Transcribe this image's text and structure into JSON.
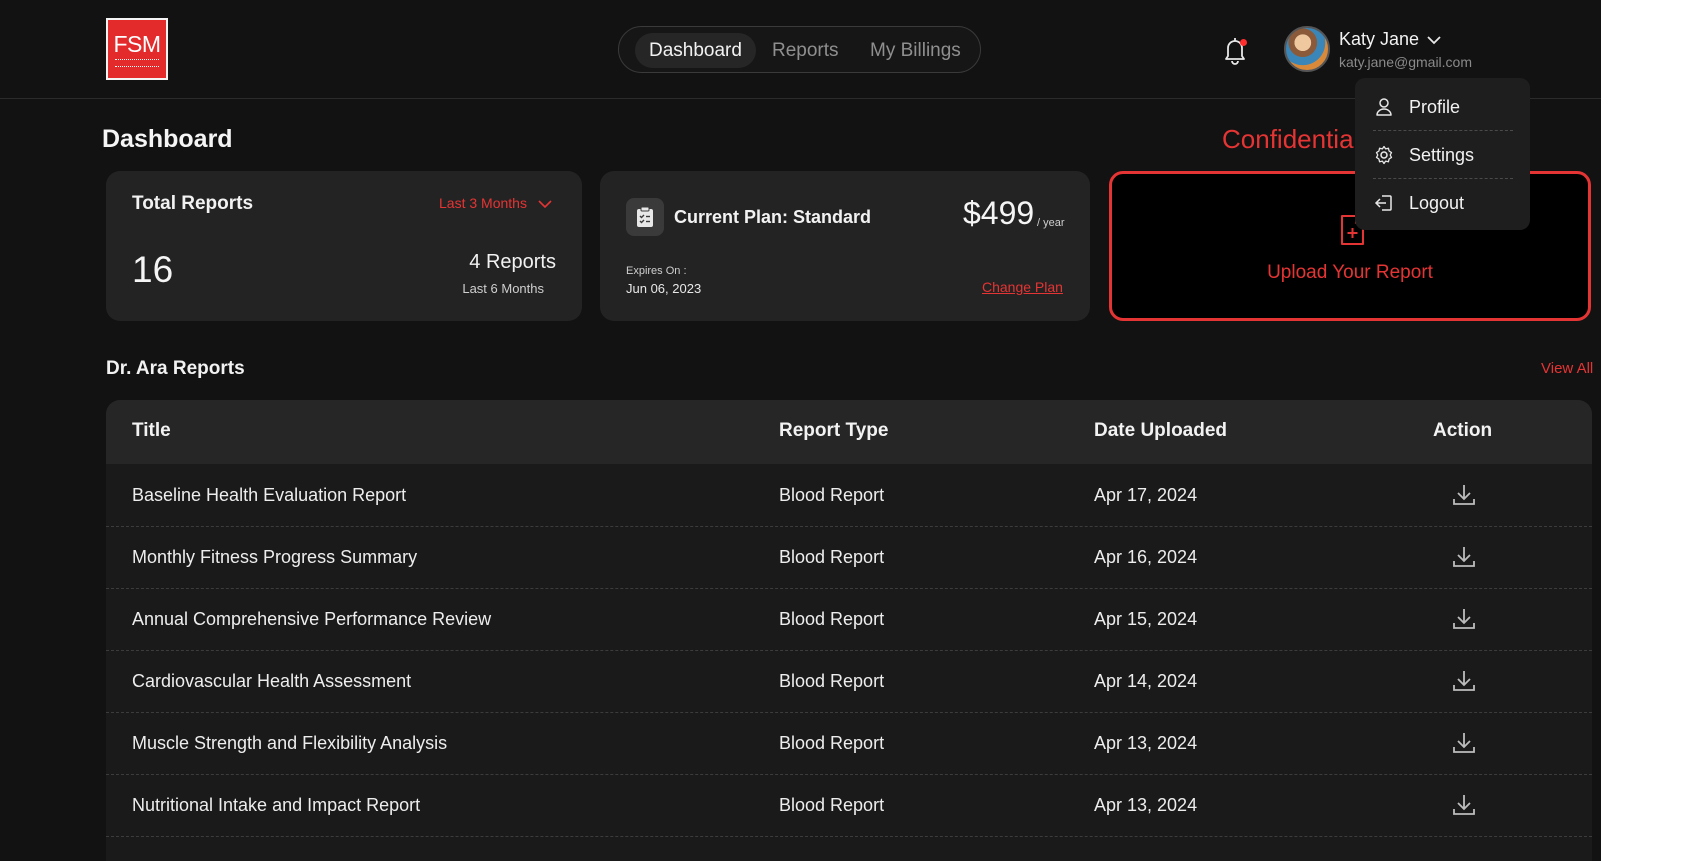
{
  "header": {
    "logo_text": "FSM",
    "nav_tabs": [
      {
        "label": "Dashboard",
        "active": true
      },
      {
        "label": "Reports",
        "active": false
      },
      {
        "label": "My Billings",
        "active": false
      }
    ],
    "notification_icon": "bell-icon",
    "user": {
      "name": "Katy Jane",
      "email": "katy.jane@gmail.com"
    }
  },
  "dropdown": {
    "items": [
      {
        "label": "Profile",
        "icon": "user-icon"
      },
      {
        "label": "Settings",
        "icon": "gear-icon"
      },
      {
        "label": "Logout",
        "icon": "logout-icon"
      }
    ]
  },
  "page": {
    "title": "Dashboard",
    "confidential_label": "Confidentia"
  },
  "cards": {
    "total_reports": {
      "title": "Total Reports",
      "filter": "Last 3 Months",
      "value": "16",
      "secondary_value": "4 Reports",
      "secondary_label": "Last 6 Months"
    },
    "plan": {
      "title": "Current Plan: Standard",
      "price": "$499",
      "period": "/ year",
      "expires_label": "Expires On :",
      "expires_date": "Jun 06, 2023",
      "change_label": "Change Plan"
    },
    "upload": {
      "label": "Upload Your Report"
    }
  },
  "reports": {
    "section_title": "Dr. Ara Reports",
    "view_all": "View All",
    "columns": [
      "Title",
      "Report Type",
      "Date Uploaded",
      "Action"
    ],
    "rows": [
      {
        "title": "Baseline Health Evaluation Report",
        "type": "Blood Report",
        "date": "Apr 17, 2024"
      },
      {
        "title": "Monthly Fitness Progress Summary",
        "type": "Blood Report",
        "date": "Apr 16, 2024"
      },
      {
        "title": "Annual Comprehensive Performance Review",
        "type": "Blood Report",
        "date": "Apr 15, 2024"
      },
      {
        "title": "Cardiovascular Health Assessment",
        "type": "Blood Report",
        "date": "Apr 14, 2024"
      },
      {
        "title": "Muscle Strength and Flexibility Analysis",
        "type": "Blood Report",
        "date": "Apr 13, 2024"
      },
      {
        "title": "Nutritional Intake and Impact Report",
        "type": "Blood Report",
        "date": "Apr 13, 2024"
      }
    ]
  },
  "colors": {
    "accent": "#e53434",
    "background": "#121212",
    "card": "#232323"
  }
}
